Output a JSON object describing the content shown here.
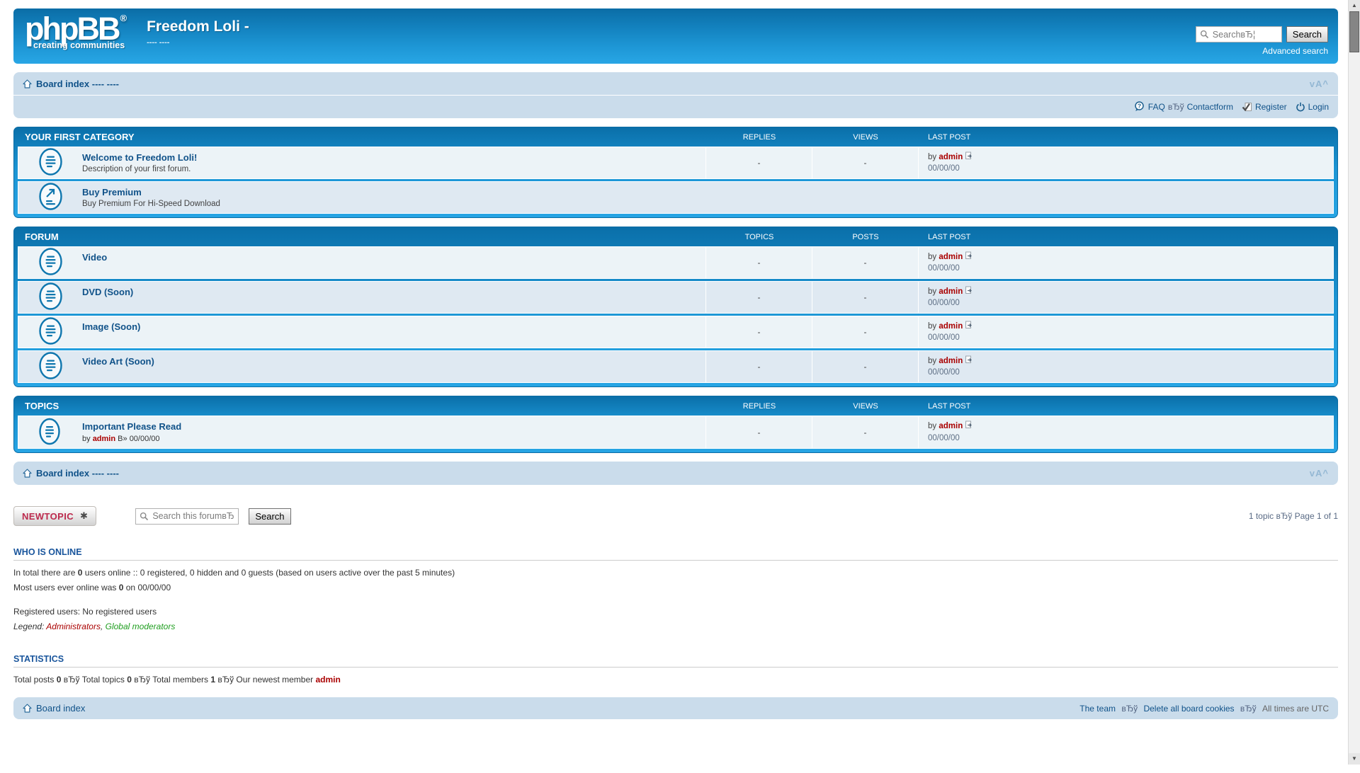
{
  "colors": {
    "header_blue_top": "#0b6da6",
    "header_blue_bottom": "#28a6e5",
    "navbar_bg": "#cadceb",
    "link_blue": "#105289",
    "username_red": "#AA0000",
    "newtopic_red": "#BC2A4D",
    "legend_green": "#1f9e1f",
    "row_odd": "#ecf3f7",
    "row_even": "#dfe9f2"
  },
  "header": {
    "logo_text": "phpBB",
    "logo_reg": "®",
    "logo_tagline": "creating communities",
    "site_title": "Freedom Loli -",
    "site_desc": "---- ----",
    "search_placeholder": "SearchвЂ¦",
    "search_button": "Search",
    "advanced_search": "Advanced search"
  },
  "nav_top": {
    "breadcrumb": "Board index ---- ----",
    "font_tool": "vA^",
    "faq": "FAQ",
    "sep": "вЂў",
    "contact": "Contactform",
    "register": "Register",
    "login": "Login"
  },
  "sections": [
    {
      "title": "YOUR FIRST CATEGORY",
      "col1": "REPLIES",
      "col2": "VIEWS",
      "col3": "LAST POST",
      "rows": [
        {
          "title": "Welcome to Freedom Loli!",
          "desc": "Description of your first forum.",
          "replies": "-",
          "views": "-",
          "by": "by",
          "user": "admin",
          "date": "00/00/00"
        },
        {
          "title": "Buy Premium",
          "desc": "Buy Premium For Hi-Speed Download"
        }
      ]
    },
    {
      "title": "FORUM",
      "col1": "TOPICS",
      "col2": "POSTS",
      "col3": "LAST POST",
      "rows": [
        {
          "title": "Video",
          "replies": "-",
          "views": "-",
          "by": "by",
          "user": "admin",
          "date": "00/00/00"
        },
        {
          "title": "DVD (Soon)",
          "replies": "-",
          "views": "-",
          "by": "by",
          "user": "admin",
          "date": "00/00/00"
        },
        {
          "title": "Image (Soon)",
          "replies": "-",
          "views": "-",
          "by": "by",
          "user": "admin",
          "date": "00/00/00"
        },
        {
          "title": "Video Art (Soon)",
          "replies": "-",
          "views": "-",
          "by": "by",
          "user": "admin",
          "date": "00/00/00"
        }
      ]
    },
    {
      "title": "TOPICS",
      "col1": "REPLIES",
      "col2": "VIEWS",
      "col3": "LAST POST",
      "rows": [
        {
          "title": "Important Please Read",
          "byline_by": "by",
          "byline_user": "admin",
          "byline_sep": "В»",
          "byline_date": "00/00/00",
          "replies": "-",
          "views": "-",
          "by": "by",
          "user": "admin",
          "date": "00/00/00"
        }
      ]
    }
  ],
  "nav_bottom": {
    "breadcrumb": "Board index ---- ----",
    "font_tool": "vA^"
  },
  "action_bar": {
    "new_topic": "NEWTOPIC",
    "new_topic_star": "✱",
    "search_placeholder": "Search this forumвЂ¦",
    "search_button": "Search",
    "pagination": "1 topic вЂў Page 1 of 1"
  },
  "who_is_online": {
    "title": "WHO IS ONLINE",
    "line1_pre": "In total there are ",
    "line1_count": "0",
    "line1_post": " users online :: 0 registered, 0 hidden and 0 guests (based on users active over the past 5 minutes)",
    "line2_pre": "Most users ever online was ",
    "line2_count": "0",
    "line2_post": " on 00/00/00",
    "registered": "Registered users: No registered users",
    "legend_label": "Legend: ",
    "legend_admins": "Administrators",
    "legend_comma": ", ",
    "legend_mods": "Global moderators"
  },
  "statistics": {
    "title": "STATISTICS",
    "p1": "Total posts ",
    "v1": "0",
    "p2": " вЂў Total topics ",
    "v2": "0",
    "p3": " вЂў Total members ",
    "v3": "1",
    "p4": " вЂў Our newest member ",
    "v4": "admin"
  },
  "footer": {
    "breadcrumb": "Board index",
    "team": "The team",
    "sep1": "вЂў",
    "cookies": "Delete all board cookies",
    "sep2": "вЂў",
    "times": "All times are UTC"
  }
}
